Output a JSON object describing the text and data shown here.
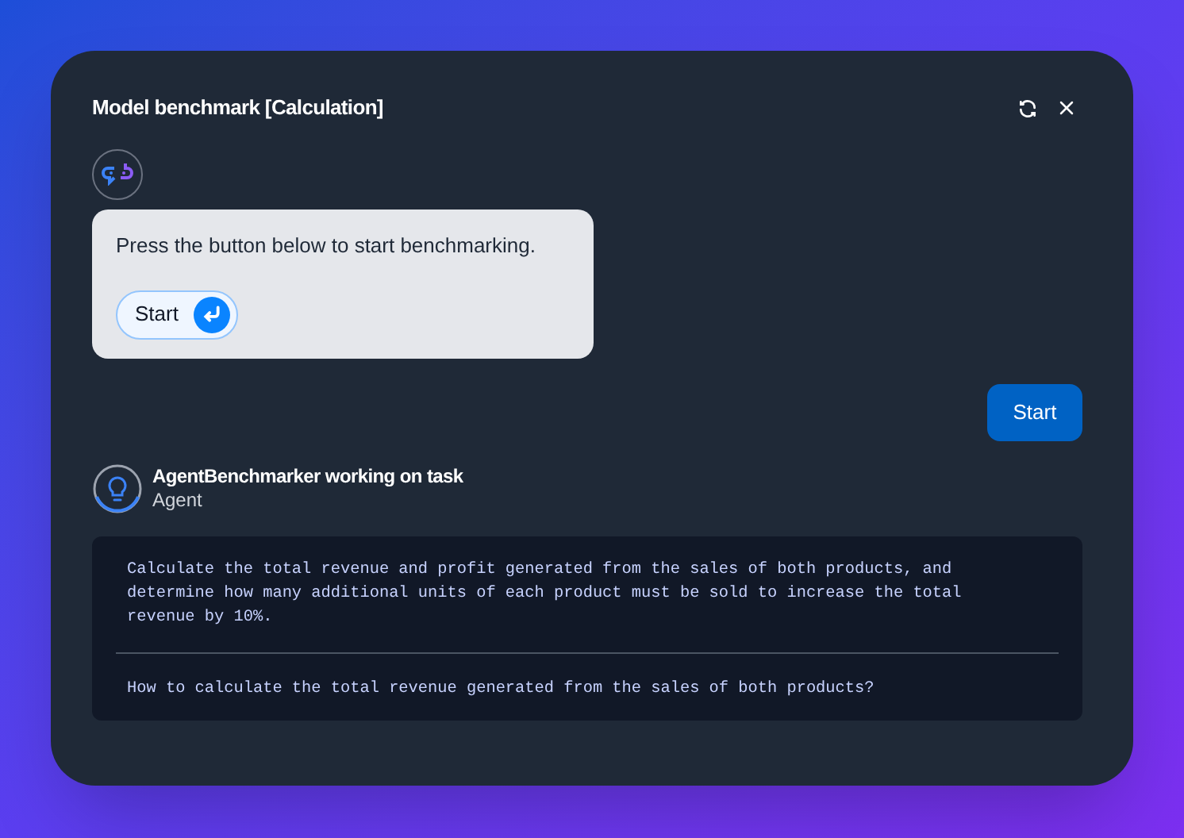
{
  "window": {
    "title": "Model benchmark [Calculation]"
  },
  "bot_message": {
    "text": "Press the button below to start benchmarking.",
    "button": "Start"
  },
  "user_message": {
    "text": "Start"
  },
  "agent": {
    "name": "AgentBenchmarker working on task",
    "role": "Agent"
  },
  "task": {
    "description": "Calculate the total revenue and profit generated from the sales of both products, and determine how many additional units of each product must be sold to increase the total revenue by 10%.",
    "question": "How to calculate the total revenue generated from the sales of both products?"
  }
}
